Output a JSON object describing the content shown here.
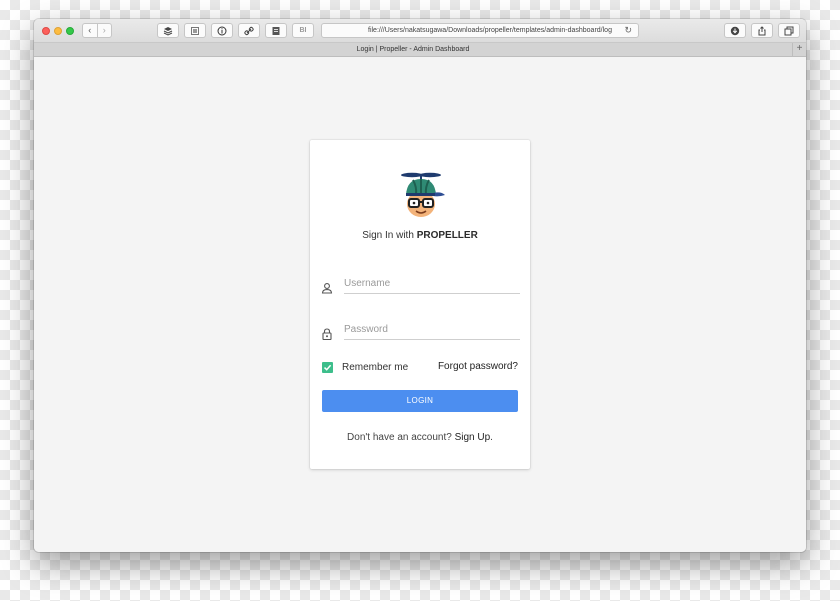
{
  "browser": {
    "address_url": "file:///Users/nakatsugawa/Downloads/propeller/templates/admin-dashboard/log",
    "tab_title": "Login | Propeller - Admin Dashboard",
    "new_tab_label": "+",
    "toolbar_icons": [
      "back-icon",
      "forward-icon",
      "layers-icon",
      "reader-icon",
      "info-icon",
      "link-icon",
      "bookmark-icon",
      "bi-icon",
      "reload-icon",
      "download-icon",
      "share-icon",
      "tabs-icon"
    ],
    "bi_label": "BI"
  },
  "login": {
    "sign_in_prefix": "Sign In",
    "sign_in_with": "with",
    "brand": "PROPELLER",
    "username_placeholder": "Username",
    "password_placeholder": "Password",
    "remember_label": "Remember me",
    "remember_checked": true,
    "forgot_label": "Forgot password?",
    "login_button": "LOGIN",
    "signup_prompt": "Don't have an account?",
    "signup_link": "Sign Up"
  },
  "colors": {
    "primary_button": "#4c8ef0",
    "checkbox": "#3dbe8b"
  }
}
